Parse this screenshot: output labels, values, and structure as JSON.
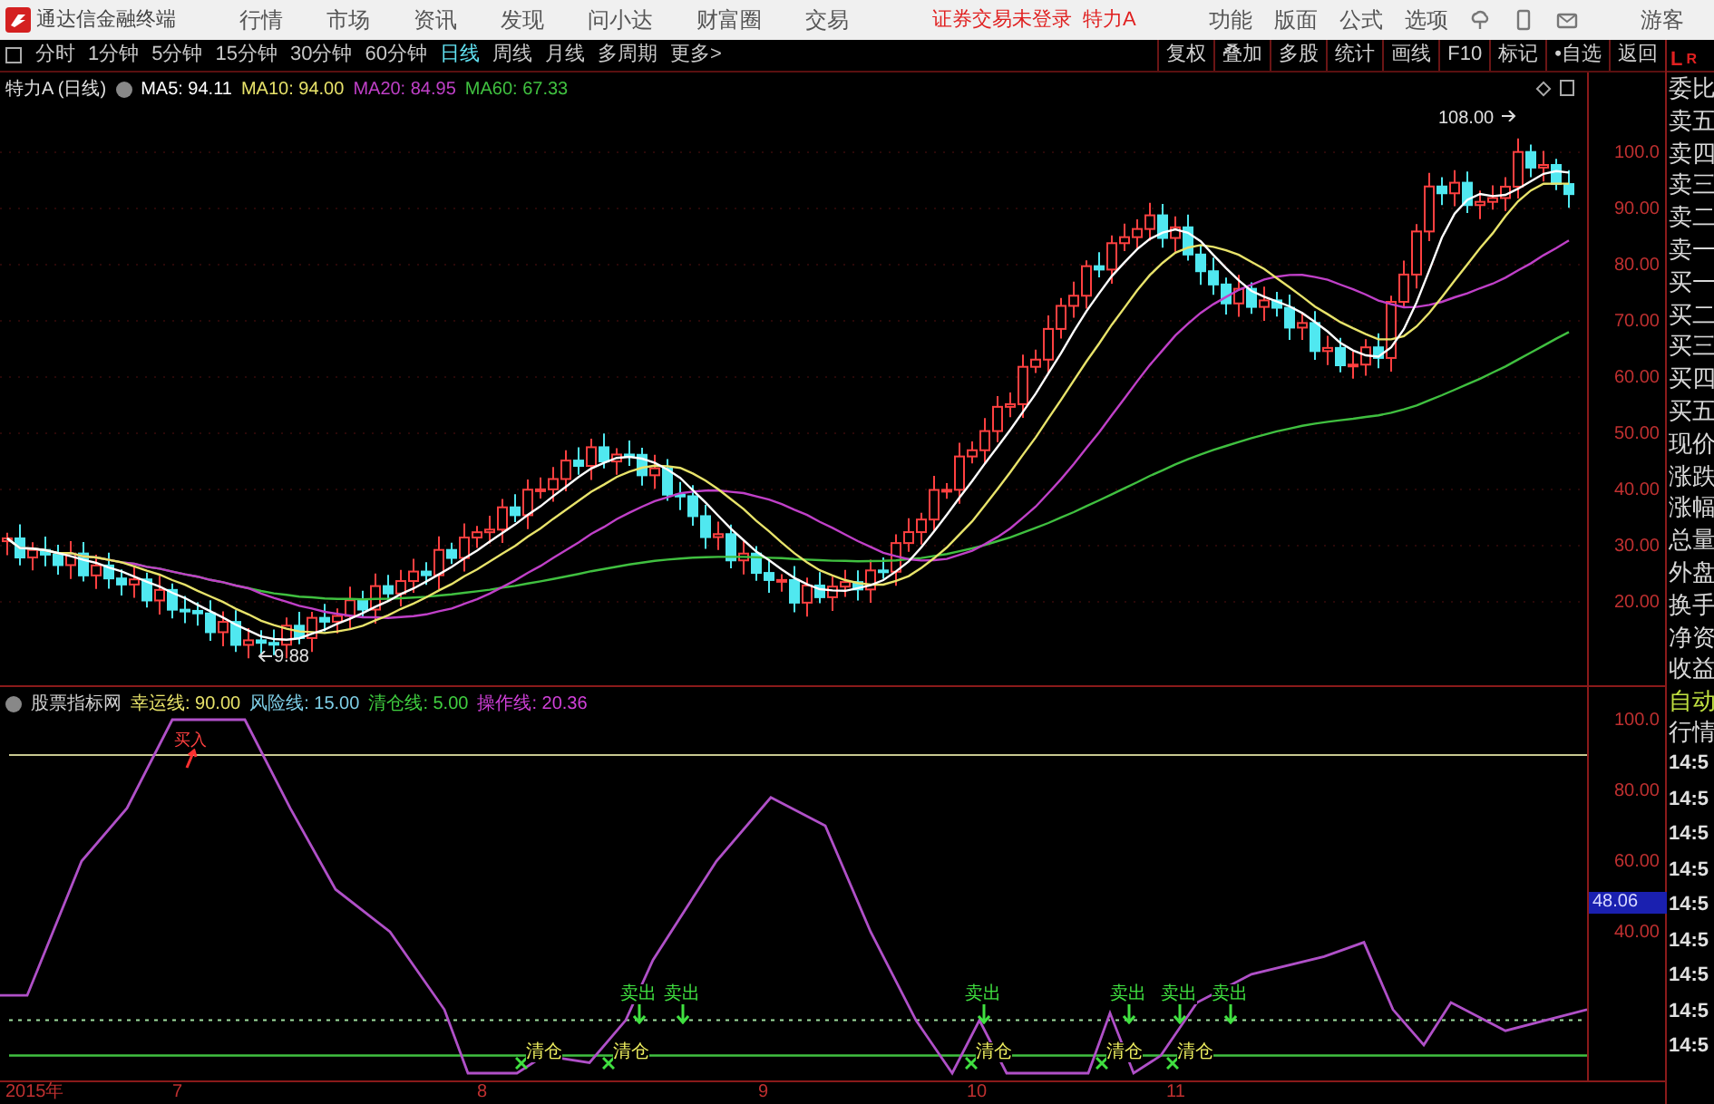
{
  "title_bar": {
    "app_name": "通达信金融终端",
    "menus": [
      "行情",
      "市场",
      "资讯",
      "发现",
      "问小达",
      "财富圈",
      "交易"
    ],
    "login_status": "证券交易未登录",
    "stock_name": "特力A",
    "tools": [
      "功能",
      "版面",
      "公式",
      "选项"
    ],
    "user": "游客"
  },
  "toolbar": {
    "periods": [
      {
        "label": "分时",
        "selected": false
      },
      {
        "label": "1分钟",
        "selected": false
      },
      {
        "label": "5分钟",
        "selected": false
      },
      {
        "label": "15分钟",
        "selected": false
      },
      {
        "label": "30分钟",
        "selected": false
      },
      {
        "label": "60分钟",
        "selected": false
      },
      {
        "label": "日线",
        "selected": true
      },
      {
        "label": "周线",
        "selected": false
      },
      {
        "label": "月线",
        "selected": false
      },
      {
        "label": "多周期",
        "selected": false
      },
      {
        "label": "更多>",
        "selected": false
      }
    ],
    "buttons": [
      "复权",
      "叠加",
      "多股",
      "统计",
      "画线",
      "F10",
      "标记",
      "•自选",
      "返回"
    ]
  },
  "price_panel": {
    "title": "特力A (日线)",
    "legend": [
      {
        "label": "MA5: 94.11",
        "color": "#ffffff"
      },
      {
        "label": "MA10: 94.00",
        "color": "#e8e36a"
      },
      {
        "label": "MA20: 84.95",
        "color": "#c040c8"
      },
      {
        "label": "MA60: 67.33",
        "color": "#40c040"
      }
    ],
    "high_label": "108.00",
    "low_label": "9.88",
    "axis_labels": [
      "100.0",
      "90.00",
      "80.00",
      "70.00",
      "60.00",
      "50.00",
      "40.00",
      "30.00",
      "20.00"
    ]
  },
  "indicator_panel": {
    "title": "股票指标网",
    "legend": [
      {
        "label": "幸运线: 90.00",
        "color": "#e8e36a"
      },
      {
        "label": "风险线: 15.00",
        "color": "#7fd0e8"
      },
      {
        "label": "清仓线: 5.00",
        "color": "#40d040"
      },
      {
        "label": "操作线: 20.36",
        "color": "#d040d8"
      }
    ],
    "axis_labels": [
      "100.0",
      "80.00",
      "60.00",
      "40.00"
    ],
    "current_value": "48.06",
    "signals": [
      {
        "kind": "buy",
        "label": "买入"
      },
      {
        "kind": "clear",
        "label": "清仓"
      },
      {
        "kind": "clear",
        "label": "清仓"
      },
      {
        "kind": "sell",
        "label": "卖出"
      },
      {
        "kind": "sell",
        "label": "卖出"
      },
      {
        "kind": "sell",
        "label": "卖出"
      },
      {
        "kind": "clear",
        "label": "清仓"
      },
      {
        "kind": "clear",
        "label": "清仓"
      },
      {
        "kind": "sell",
        "label": "卖出"
      },
      {
        "kind": "sell",
        "label": "卖出"
      },
      {
        "kind": "clear",
        "label": "清仓"
      },
      {
        "kind": "sell",
        "label": "卖出"
      }
    ]
  },
  "date_axis": [
    "2015年",
    "7",
    "8",
    "9",
    "10",
    "11"
  ],
  "quote_panel": {
    "corner": [
      "L",
      "R"
    ],
    "fields": [
      "委比",
      "卖五",
      "卖四",
      "卖三",
      "卖二",
      "卖一",
      "买一",
      "买二",
      "买三",
      "买四",
      "买五",
      "现价",
      "涨跌",
      "涨幅",
      "总量",
      "外盘",
      "换手",
      "净资",
      "收益"
    ],
    "auto": [
      "自动",
      "行情"
    ],
    "times": [
      "14:5",
      "14:5",
      "14:5",
      "14:5",
      "14:5",
      "14:5",
      "14:5",
      "14:5",
      "14:5"
    ]
  }
}
